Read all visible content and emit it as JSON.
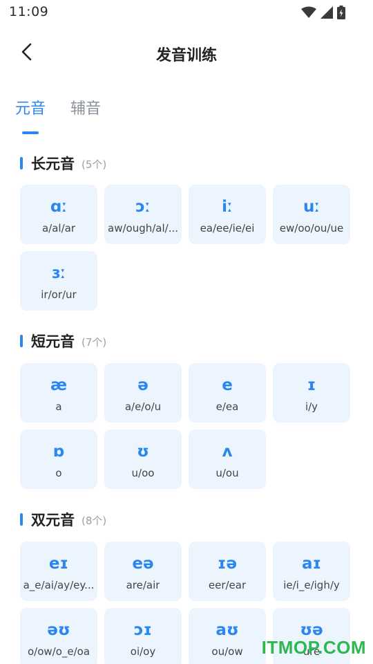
{
  "status_bar": {
    "time": "11:09"
  },
  "header": {
    "title": "发音训练"
  },
  "tabs": [
    {
      "label": "元音",
      "active": true
    },
    {
      "label": "辅音",
      "active": false
    }
  ],
  "sections": [
    {
      "title": "长元音",
      "count": "(5个)",
      "cards": [
        {
          "symbol": "ɑː",
          "spelling": "a/al/ar"
        },
        {
          "symbol": "ɔː",
          "spelling": "aw/ough/al/..."
        },
        {
          "symbol": "iː",
          "spelling": "ea/ee/ie/ei"
        },
        {
          "symbol": "uː",
          "spelling": "ew/oo/ou/ue"
        },
        {
          "symbol": "ɜː",
          "spelling": "ir/or/ur"
        }
      ]
    },
    {
      "title": "短元音",
      "count": "(7个)",
      "cards": [
        {
          "symbol": "æ",
          "spelling": "a"
        },
        {
          "symbol": "ə",
          "spelling": "a/e/o/u"
        },
        {
          "symbol": "e",
          "spelling": "e/ea"
        },
        {
          "symbol": "ɪ",
          "spelling": "i/y"
        },
        {
          "symbol": "ɒ",
          "spelling": "o"
        },
        {
          "symbol": "ʊ",
          "spelling": "u/oo"
        },
        {
          "symbol": "ʌ",
          "spelling": "u/ou"
        }
      ]
    },
    {
      "title": "双元音",
      "count": "(8个)",
      "cards": [
        {
          "symbol": "eɪ",
          "spelling": "a_e/ai/ay/ey..."
        },
        {
          "symbol": "eə",
          "spelling": "are/air"
        },
        {
          "symbol": "ɪə",
          "spelling": "eer/ear"
        },
        {
          "symbol": "aɪ",
          "spelling": "ie/i_e/igh/y"
        },
        {
          "symbol": "əʊ",
          "spelling": "o/ow/o_e/oa"
        },
        {
          "symbol": "ɔɪ",
          "spelling": "oi/oy"
        },
        {
          "symbol": "aʊ",
          "spelling": "ou/ow"
        },
        {
          "symbol": "ʊə",
          "spelling": "ure"
        }
      ]
    }
  ],
  "watermark": "ITMOP.COM",
  "colors": {
    "accent": "#2b87ee",
    "card_bg": "#ecf4fe",
    "watermark": "#2eb84f"
  }
}
